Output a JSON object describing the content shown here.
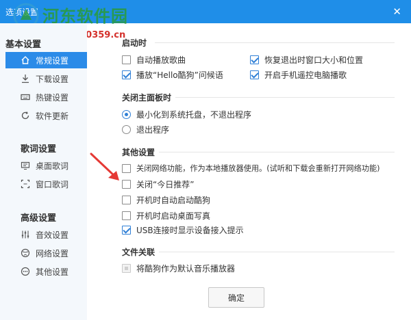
{
  "window": {
    "title": "选项设置",
    "close_glyph": "✕",
    "watermark_text": "河东软件园",
    "watermark_url": "www.pc0359.cn"
  },
  "sidebar": {
    "sections": [
      {
        "title": "基本设置",
        "items": [
          {
            "label": "常规设置",
            "icon": "home-icon",
            "active": true
          },
          {
            "label": "下载设置",
            "icon": "download-icon",
            "active": false
          },
          {
            "label": "热键设置",
            "icon": "keyboard-icon",
            "active": false
          },
          {
            "label": "软件更新",
            "icon": "refresh-icon",
            "active": false
          }
        ]
      },
      {
        "title": "歌词设置",
        "items": [
          {
            "label": "桌面歌词",
            "icon": "desktop-lyrics-icon",
            "active": false
          },
          {
            "label": "窗口歌词",
            "icon": "window-lyrics-icon",
            "active": false
          }
        ]
      },
      {
        "title": "高级设置",
        "items": [
          {
            "label": "音效设置",
            "icon": "equalizer-icon",
            "active": false
          },
          {
            "label": "网络设置",
            "icon": "network-icon",
            "active": false
          },
          {
            "label": "其他设置",
            "icon": "more-icon",
            "active": false
          }
        ]
      }
    ]
  },
  "groups": {
    "startup": {
      "title": "启动时",
      "options": [
        {
          "label": "自动播放歌曲",
          "checked": false
        },
        {
          "label": "恢复退出时窗口大小和位置",
          "checked": true
        },
        {
          "label": "播放“Hello酷狗”问候语",
          "checked": true
        },
        {
          "label": "开启手机遥控电脑播歌",
          "checked": true
        }
      ]
    },
    "close_panel": {
      "title": "关闭主面板时",
      "options": [
        {
          "label": "最小化到系统托盘，不退出程序",
          "selected": true
        },
        {
          "label": "退出程序",
          "selected": false
        }
      ]
    },
    "other": {
      "title": "其他设置",
      "options": [
        {
          "label": "关闭网络功能，作为本地播放器使用。(试听和下载会重新打开网络功能)",
          "checked": false
        },
        {
          "label": "关闭“今日推荐”",
          "checked": false
        },
        {
          "label": "开机时自动启动酷狗",
          "checked": false
        },
        {
          "label": "开机时启动桌面写真",
          "checked": false
        },
        {
          "label": "USB连接时显示设备接入提示",
          "checked": true
        }
      ]
    },
    "file_assoc": {
      "title": "文件关联",
      "options": [
        {
          "label": "将酷狗作为默认音乐播放器",
          "checked": false,
          "disabled": true
        }
      ]
    }
  },
  "footer": {
    "ok_label": "确定"
  },
  "colors": {
    "titlebar": "#1f8ee8",
    "active_nav": "#2b8be8",
    "check": "#2f7fd6",
    "annotation_arrow": "#e53935"
  }
}
